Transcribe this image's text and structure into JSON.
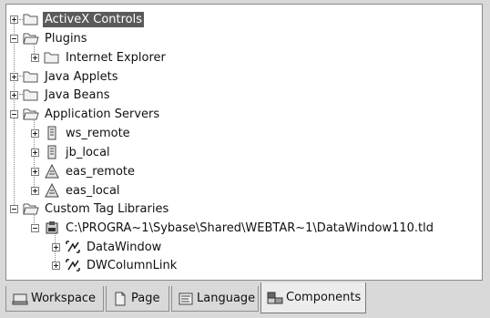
{
  "tree": {
    "items": [
      {
        "label": "ActiveX Controls",
        "icon": "folder-closed-icon",
        "expander": "plus"
      },
      {
        "label": "Plugins",
        "icon": "folder-open-icon",
        "expander": "minus"
      },
      {
        "label": "Internet Explorer",
        "icon": "folder-closed-icon",
        "expander": "plus"
      },
      {
        "label": "Java Applets",
        "icon": "folder-closed-icon",
        "expander": "plus"
      },
      {
        "label": "Java Beans",
        "icon": "folder-closed-icon",
        "expander": "plus"
      },
      {
        "label": "Application Servers",
        "icon": "folder-open-icon",
        "expander": "minus"
      },
      {
        "label": "ws_remote",
        "icon": "server-icon",
        "expander": "plus"
      },
      {
        "label": "jb_local",
        "icon": "server-icon",
        "expander": "plus"
      },
      {
        "label": "eas_remote",
        "icon": "eas-server-icon",
        "expander": "plus"
      },
      {
        "label": "eas_local",
        "icon": "eas-server-icon",
        "expander": "plus"
      },
      {
        "label": "Custom Tag Libraries",
        "icon": "folder-open-icon",
        "expander": "minus"
      },
      {
        "label": "C:\\PROGRA~1\\Sybase\\Shared\\WEBTAR~1\\DataWindow110.tld",
        "icon": "tag-library-icon",
        "expander": "minus"
      },
      {
        "label": "DataWindow",
        "icon": "custom-tag-icon",
        "expander": "plus"
      },
      {
        "label": "DWColumnLink",
        "icon": "custom-tag-icon",
        "expander": "plus"
      }
    ]
  },
  "tabs": [
    {
      "label": "Workspace",
      "icon": "workspace-icon"
    },
    {
      "label": "Page",
      "icon": "page-icon"
    },
    {
      "label": "Language",
      "icon": "language-icon"
    },
    {
      "label": "Components",
      "icon": "components-icon",
      "active": true
    }
  ]
}
